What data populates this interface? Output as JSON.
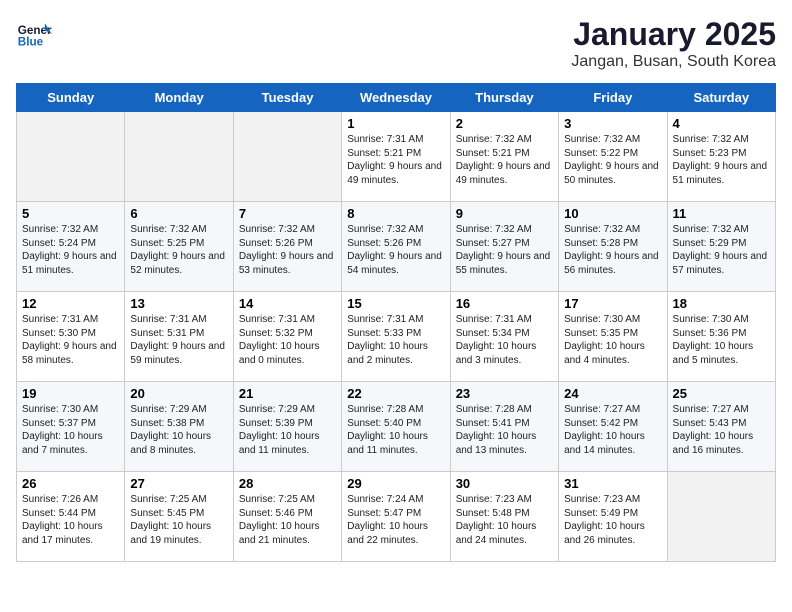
{
  "header": {
    "logo_line1": "General",
    "logo_line2": "Blue",
    "title": "January 2025",
    "subtitle": "Jangan, Busan, South Korea"
  },
  "weekdays": [
    "Sunday",
    "Monday",
    "Tuesday",
    "Wednesday",
    "Thursday",
    "Friday",
    "Saturday"
  ],
  "weeks": [
    [
      {
        "day": "",
        "empty": true
      },
      {
        "day": "",
        "empty": true
      },
      {
        "day": "",
        "empty": true
      },
      {
        "day": "1",
        "sunrise": "7:31 AM",
        "sunset": "5:21 PM",
        "daylight": "9 hours and 49 minutes."
      },
      {
        "day": "2",
        "sunrise": "7:32 AM",
        "sunset": "5:21 PM",
        "daylight": "9 hours and 49 minutes."
      },
      {
        "day": "3",
        "sunrise": "7:32 AM",
        "sunset": "5:22 PM",
        "daylight": "9 hours and 50 minutes."
      },
      {
        "day": "4",
        "sunrise": "7:32 AM",
        "sunset": "5:23 PM",
        "daylight": "9 hours and 51 minutes."
      }
    ],
    [
      {
        "day": "5",
        "sunrise": "7:32 AM",
        "sunset": "5:24 PM",
        "daylight": "9 hours and 51 minutes."
      },
      {
        "day": "6",
        "sunrise": "7:32 AM",
        "sunset": "5:25 PM",
        "daylight": "9 hours and 52 minutes."
      },
      {
        "day": "7",
        "sunrise": "7:32 AM",
        "sunset": "5:26 PM",
        "daylight": "9 hours and 53 minutes."
      },
      {
        "day": "8",
        "sunrise": "7:32 AM",
        "sunset": "5:26 PM",
        "daylight": "9 hours and 54 minutes."
      },
      {
        "day": "9",
        "sunrise": "7:32 AM",
        "sunset": "5:27 PM",
        "daylight": "9 hours and 55 minutes."
      },
      {
        "day": "10",
        "sunrise": "7:32 AM",
        "sunset": "5:28 PM",
        "daylight": "9 hours and 56 minutes."
      },
      {
        "day": "11",
        "sunrise": "7:32 AM",
        "sunset": "5:29 PM",
        "daylight": "9 hours and 57 minutes."
      }
    ],
    [
      {
        "day": "12",
        "sunrise": "7:31 AM",
        "sunset": "5:30 PM",
        "daylight": "9 hours and 58 minutes."
      },
      {
        "day": "13",
        "sunrise": "7:31 AM",
        "sunset": "5:31 PM",
        "daylight": "9 hours and 59 minutes."
      },
      {
        "day": "14",
        "sunrise": "7:31 AM",
        "sunset": "5:32 PM",
        "daylight": "10 hours and 0 minutes."
      },
      {
        "day": "15",
        "sunrise": "7:31 AM",
        "sunset": "5:33 PM",
        "daylight": "10 hours and 2 minutes."
      },
      {
        "day": "16",
        "sunrise": "7:31 AM",
        "sunset": "5:34 PM",
        "daylight": "10 hours and 3 minutes."
      },
      {
        "day": "17",
        "sunrise": "7:30 AM",
        "sunset": "5:35 PM",
        "daylight": "10 hours and 4 minutes."
      },
      {
        "day": "18",
        "sunrise": "7:30 AM",
        "sunset": "5:36 PM",
        "daylight": "10 hours and 5 minutes."
      }
    ],
    [
      {
        "day": "19",
        "sunrise": "7:30 AM",
        "sunset": "5:37 PM",
        "daylight": "10 hours and 7 minutes."
      },
      {
        "day": "20",
        "sunrise": "7:29 AM",
        "sunset": "5:38 PM",
        "daylight": "10 hours and 8 minutes."
      },
      {
        "day": "21",
        "sunrise": "7:29 AM",
        "sunset": "5:39 PM",
        "daylight": "10 hours and 11 minutes."
      },
      {
        "day": "22",
        "sunrise": "7:28 AM",
        "sunset": "5:40 PM",
        "daylight": "10 hours and 11 minutes."
      },
      {
        "day": "23",
        "sunrise": "7:28 AM",
        "sunset": "5:41 PM",
        "daylight": "10 hours and 13 minutes."
      },
      {
        "day": "24",
        "sunrise": "7:27 AM",
        "sunset": "5:42 PM",
        "daylight": "10 hours and 14 minutes."
      },
      {
        "day": "25",
        "sunrise": "7:27 AM",
        "sunset": "5:43 PM",
        "daylight": "10 hours and 16 minutes."
      }
    ],
    [
      {
        "day": "26",
        "sunrise": "7:26 AM",
        "sunset": "5:44 PM",
        "daylight": "10 hours and 17 minutes."
      },
      {
        "day": "27",
        "sunrise": "7:25 AM",
        "sunset": "5:45 PM",
        "daylight": "10 hours and 19 minutes."
      },
      {
        "day": "28",
        "sunrise": "7:25 AM",
        "sunset": "5:46 PM",
        "daylight": "10 hours and 21 minutes."
      },
      {
        "day": "29",
        "sunrise": "7:24 AM",
        "sunset": "5:47 PM",
        "daylight": "10 hours and 22 minutes."
      },
      {
        "day": "30",
        "sunrise": "7:23 AM",
        "sunset": "5:48 PM",
        "daylight": "10 hours and 24 minutes."
      },
      {
        "day": "31",
        "sunrise": "7:23 AM",
        "sunset": "5:49 PM",
        "daylight": "10 hours and 26 minutes."
      },
      {
        "day": "",
        "empty": true
      }
    ]
  ]
}
